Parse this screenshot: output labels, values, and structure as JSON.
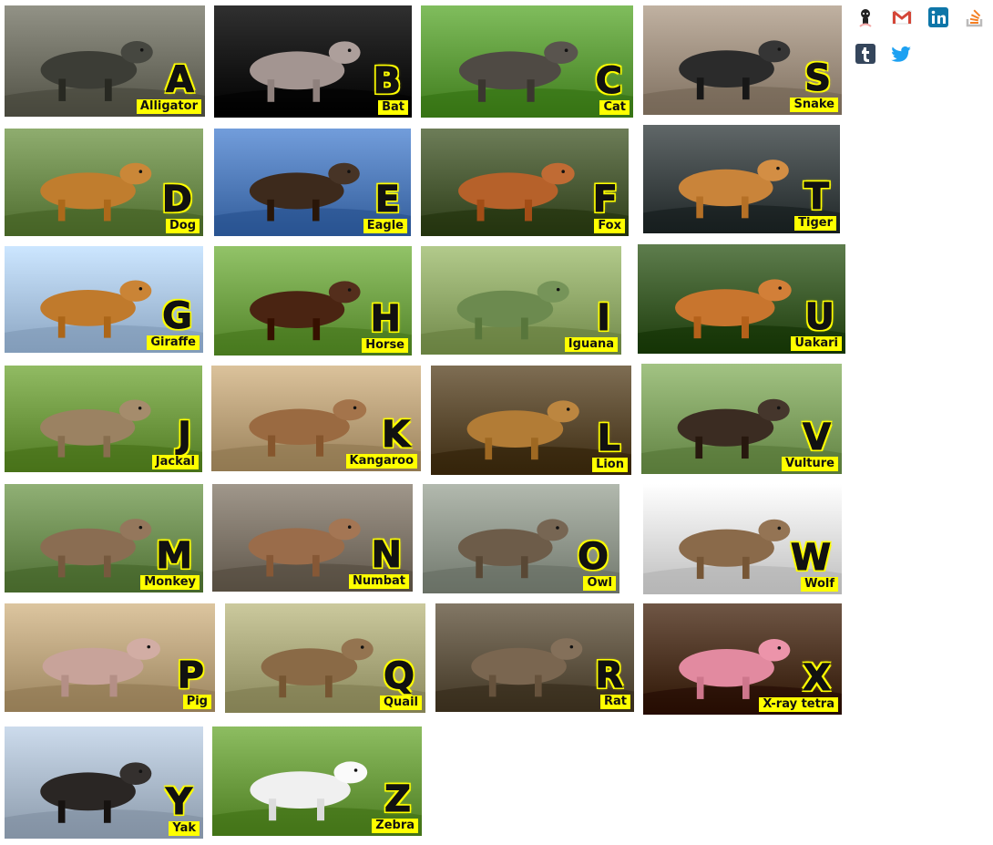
{
  "page": {
    "background": "#ffffff"
  },
  "animals": [
    {
      "letter": "A",
      "name": "Alligator",
      "scene": "#6f6f63",
      "accent": "#3c3d36"
    },
    {
      "letter": "B",
      "name": "Bat",
      "scene": "#0d0d0d",
      "accent": "#a39591"
    },
    {
      "letter": "C",
      "name": "Cat",
      "scene": "#5d9a3a",
      "accent": "#4f4a44"
    },
    {
      "letter": "S",
      "name": "Snake",
      "scene": "#9d8e7e",
      "accent": "#2b2b2b"
    },
    {
      "letter": "D",
      "name": "Dog",
      "scene": "#6c8a4c",
      "accent": "#c07d2e"
    },
    {
      "letter": "E",
      "name": "Eagle",
      "scene": "#4f7ab8",
      "accent": "#3d2a1c"
    },
    {
      "letter": "F",
      "name": "Fox",
      "scene": "#4a5a35",
      "accent": "#b6612a"
    },
    {
      "letter": "T",
      "name": "Tiger",
      "scene": "#3d4445",
      "accent": "#c9843a"
    },
    {
      "letter": "G",
      "name": "Giraffe",
      "scene": "#a9c3e0",
      "accent": "#c07a2c"
    },
    {
      "letter": "H",
      "name": "Horse",
      "scene": "#6fa045",
      "accent": "#4a2412"
    },
    {
      "letter": "I",
      "name": "Iguana",
      "scene": "#8fa768",
      "accent": "#6c8a4f"
    },
    {
      "letter": "U",
      "name": "Uakari",
      "scene": "#3b5a2a",
      "accent": "#c8752e"
    },
    {
      "letter": "J",
      "name": "Jackal",
      "scene": "#6e9840",
      "accent": "#9b8262"
    },
    {
      "letter": "K",
      "name": "Kangaroo",
      "scene": "#b89f78",
      "accent": "#9a6a41"
    },
    {
      "letter": "L",
      "name": "Lion",
      "scene": "#5b4a30",
      "accent": "#b27c36"
    },
    {
      "letter": "V",
      "name": "Vulture",
      "scene": "#7fa060",
      "accent": "#3b2c22"
    },
    {
      "letter": "M",
      "name": "Monkey",
      "scene": "#6d8d52",
      "accent": "#8a6d52"
    },
    {
      "letter": "N",
      "name": "Numbat",
      "scene": "#7d7468",
      "accent": "#9a6c4a"
    },
    {
      "letter": "O",
      "name": "Owl",
      "scene": "#8f968b",
      "accent": "#6d5c49"
    },
    {
      "letter": "W",
      "name": "Wolf",
      "scene": "#dcdcdc",
      "accent": "#8a6a4a"
    },
    {
      "letter": "P",
      "name": "Pig",
      "scene": "#b9a27c",
      "accent": "#c8a39a"
    },
    {
      "letter": "Q",
      "name": "Quail",
      "scene": "#a8a67a",
      "accent": "#8a6a46"
    },
    {
      "letter": "R",
      "name": "Rat",
      "scene": "#5f5442",
      "accent": "#7a6650"
    },
    {
      "letter": "X",
      "name": "X-ray tetra",
      "scene": "#4c3322",
      "accent": "#e28aa0"
    },
    {
      "letter": "Y",
      "name": "Yak",
      "scene": "#a9b8c9",
      "accent": "#2a2624"
    },
    {
      "letter": "Z",
      "name": "Zebra",
      "scene": "#6a9a3e",
      "accent": "#f0f0f0"
    }
  ],
  "social_links": [
    {
      "icon": "github-icon",
      "label": "GitHub",
      "color": "#222222"
    },
    {
      "icon": "gmail-icon",
      "label": "Gmail",
      "color": "#d44638"
    },
    {
      "icon": "linkedin-icon",
      "label": "LinkedIn",
      "color": "#0e76a8"
    },
    {
      "icon": "stackoverflow-icon",
      "label": "Stack Overflow",
      "color": "#f48024"
    },
    {
      "icon": "tumblr-icon",
      "label": "Tumblr",
      "color": "#35465c"
    },
    {
      "icon": "twitter-icon",
      "label": "Twitter",
      "color": "#1da1f2"
    }
  ]
}
